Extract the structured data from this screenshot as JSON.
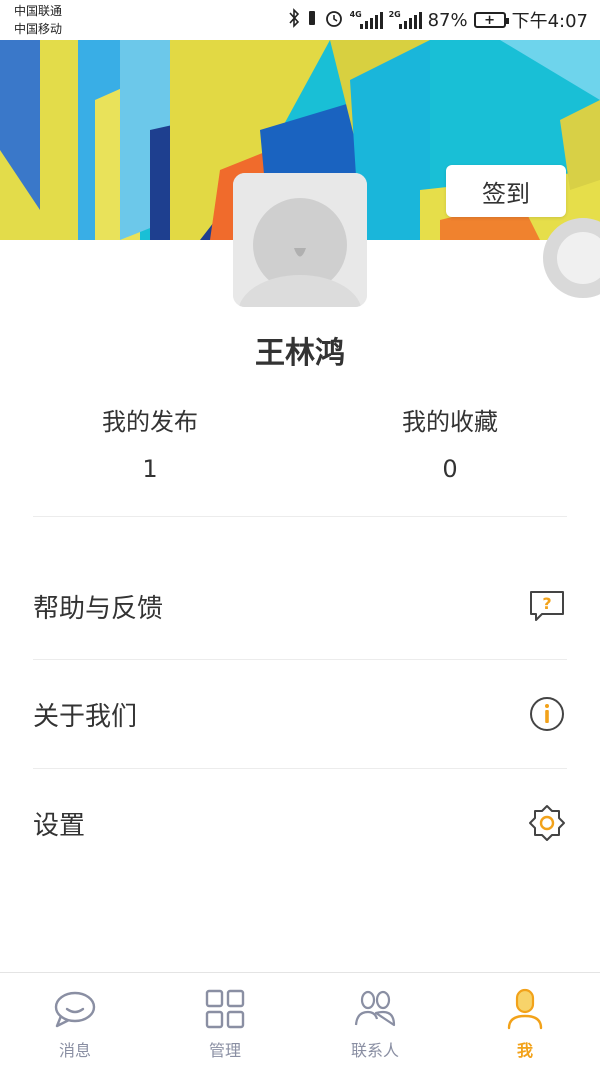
{
  "status_bar": {
    "carrier_1": "中国联通",
    "carrier_2": "中国移动",
    "network_1": "4G",
    "network_2": "2G",
    "battery_percent": "87%",
    "time": "下午4:07"
  },
  "header": {
    "signin_label": "签到"
  },
  "profile": {
    "username": "王林鸿"
  },
  "stats": {
    "posts_label": "我的发布",
    "posts_value": "1",
    "favorites_label": "我的收藏",
    "favorites_value": "0"
  },
  "menu": {
    "items": [
      {
        "label": "帮助与反馈",
        "icon": "help-question-icon"
      },
      {
        "label": "关于我们",
        "icon": "info-icon"
      },
      {
        "label": "设置",
        "icon": "gear-icon"
      }
    ]
  },
  "tabbar": {
    "tabs": [
      {
        "label": "消息",
        "icon": "message-bubble-icon",
        "active": false
      },
      {
        "label": "管理",
        "icon": "grid-icon",
        "active": false
      },
      {
        "label": "联系人",
        "icon": "contacts-icon",
        "active": false
      },
      {
        "label": "我",
        "icon": "person-icon",
        "active": true
      }
    ]
  },
  "colors": {
    "accent": "#f2a21a",
    "tab_inactive": "#8a8fa3",
    "banner_cyan": "#19bfd6"
  }
}
